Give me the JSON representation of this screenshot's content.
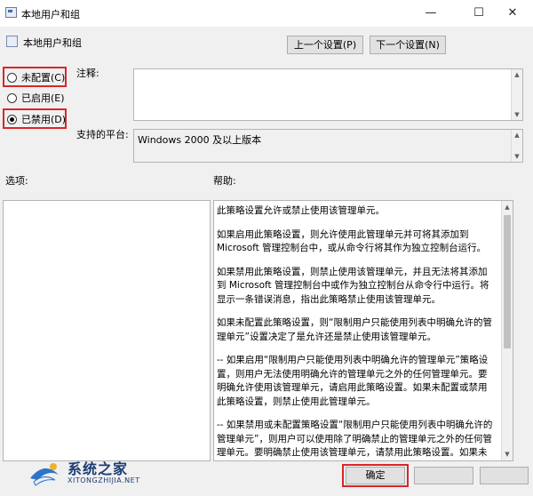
{
  "window": {
    "title": "本地用户和组",
    "minimize_glyph": "—",
    "maximize_glyph": "☐",
    "close_glyph": "✕"
  },
  "header": {
    "title": "本地用户和组",
    "prev_button": "上一个设置(P)",
    "next_button": "下一个设置(N)"
  },
  "radios": [
    {
      "label": "未配置(C)",
      "selected": false
    },
    {
      "label": "已启用(E)",
      "selected": false
    },
    {
      "label": "已禁用(D)",
      "selected": true
    }
  ],
  "comment": {
    "label": "注释:",
    "value": ""
  },
  "platform": {
    "label": "支持的平台:",
    "value": "Windows 2000 及以上版本"
  },
  "options": {
    "label": "选项:"
  },
  "help": {
    "label": "帮助:",
    "paragraphs": [
      "此策略设置允许或禁止使用该管理单元。",
      "如果启用此策略设置，则允许使用此管理单元并可将其添加到 Microsoft 管理控制台中，或从命令行将其作为独立控制台运行。",
      "如果禁用此策略设置，则禁止使用该管理单元，并且无法将其添加到 Microsoft 管理控制台中或作为独立控制台从命令行中运行。将显示一条错误消息，指出此策略禁止使用该管理单元。",
      "如果未配置此策略设置，则“限制用户只能使用列表中明确允许的管理单元”设置决定了是允许还是禁止使用该管理单元。",
      "-- 如果启用“限制用户只能使用列表中明确允许的管理单元”策略设置，则用户无法使用明确允许的管理单元之外的任何管理单元。要明确允许使用该管理单元，请启用此策略设置。如果未配置或禁用此策略设置，则禁止使用此管理单元。",
      "-- 如果禁用或未配置策略设置“限制用户只能使用列表中明确允许的管理单元”，则用户可以使用除了明确禁止的管理单元之外的任何管理单元。要明确禁止使用该管理单元，请禁用此策略设置。如果未配置或启用此策略设置，则允许使用该管理单元。"
    ]
  },
  "footer": {
    "ok_button": "确定"
  },
  "watermark": {
    "name": "系统之家",
    "url": "XITONGZHIJIA.NET"
  },
  "colors": {
    "highlight_box": "#d9262b",
    "watermark": "#1d3d74"
  }
}
